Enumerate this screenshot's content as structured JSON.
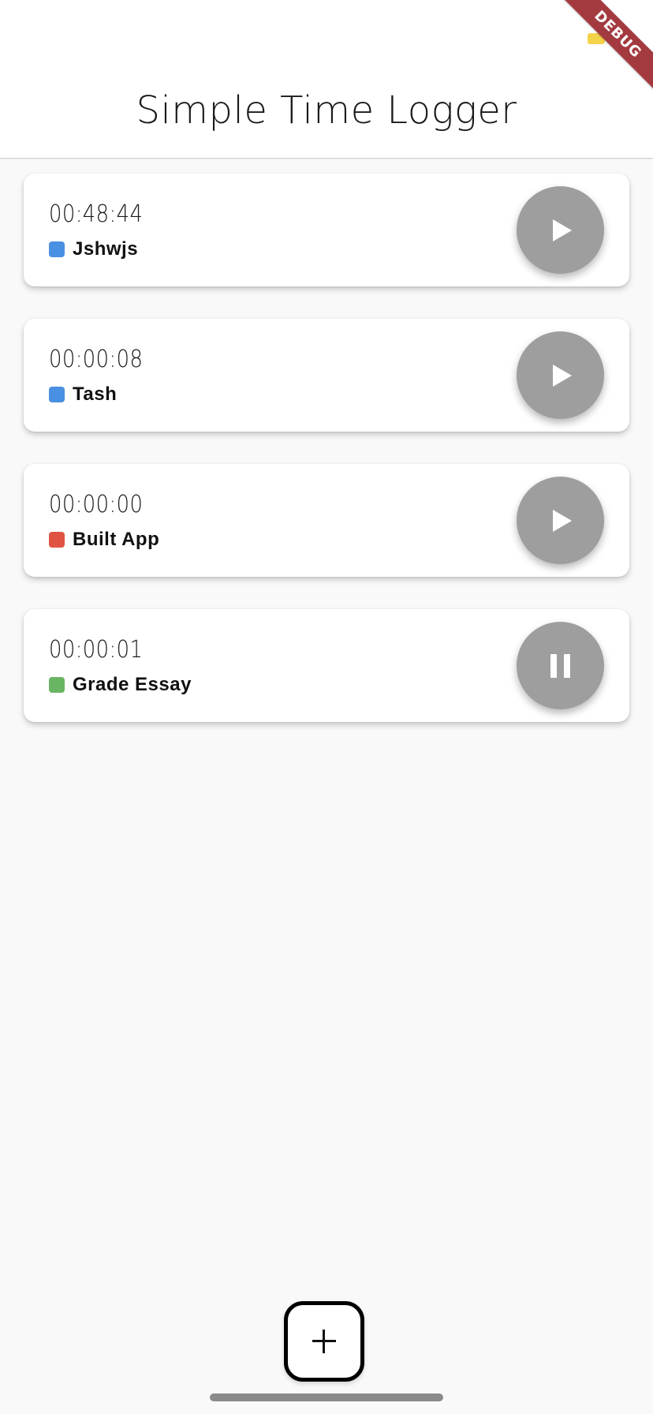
{
  "app": {
    "title": "Simple Time Logger",
    "debug_banner": "DEBUG"
  },
  "tasks": [
    {
      "time": "00:48:44",
      "name": "Jshwjs",
      "color": "#4a90e2",
      "state": "stopped",
      "action_icon": "play-icon"
    },
    {
      "time": "00:00:08",
      "name": "Tash",
      "color": "#4a90e2",
      "state": "stopped",
      "action_icon": "play-icon"
    },
    {
      "time": "00:00:00",
      "name": "Built App",
      "color": "#e05444",
      "state": "stopped",
      "action_icon": "play-icon"
    },
    {
      "time": "00:00:01",
      "name": "Grade Essay",
      "color": "#6ab563",
      "state": "running",
      "action_icon": "pause-icon"
    }
  ],
  "fab": {
    "icon": "plus-icon"
  },
  "colors": {
    "button_gray": "#9e9e9e",
    "debug_red": "#a33a3f",
    "background": "#f9f9f9"
  }
}
